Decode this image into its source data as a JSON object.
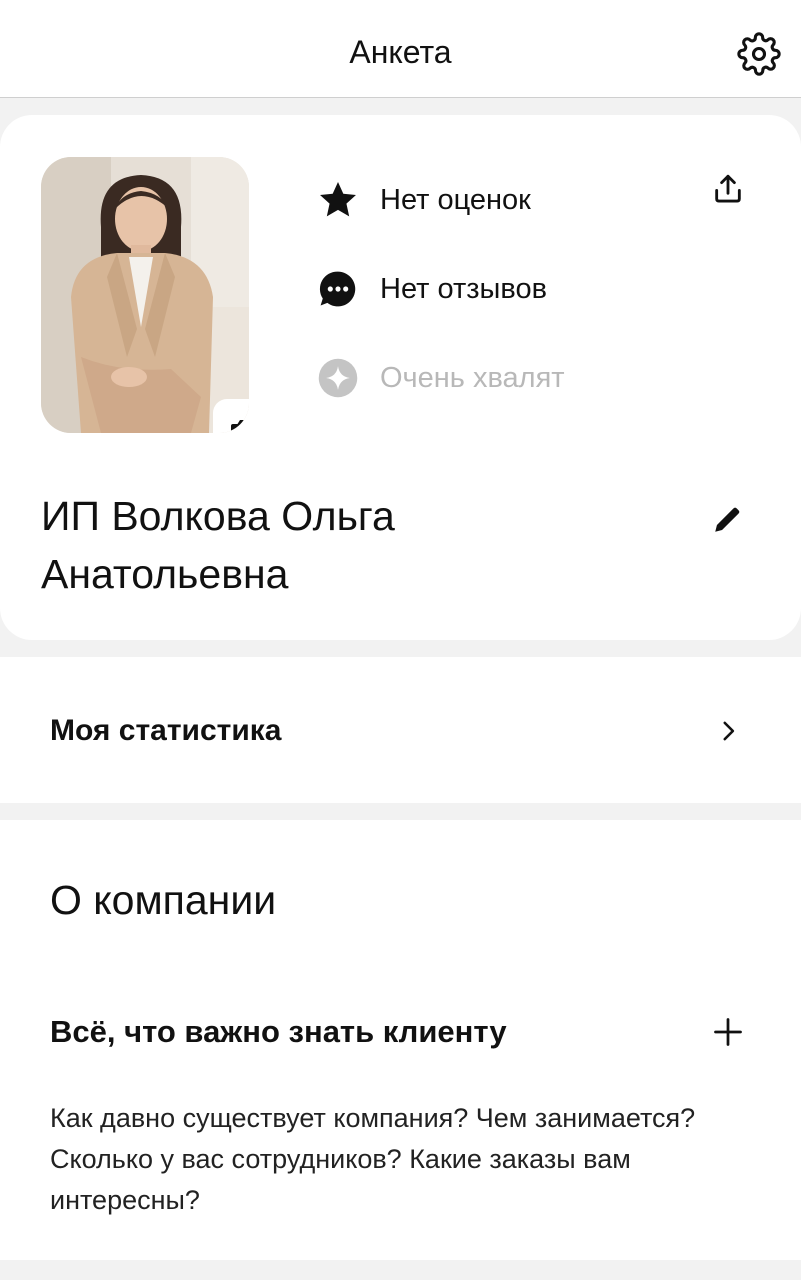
{
  "header": {
    "title": "Анкета",
    "settings_icon": "gear-icon"
  },
  "profile": {
    "photo_icon": "camera-icon",
    "rating_text": "Нет оценок",
    "reviews_text": "Нет отзывов",
    "praise_text": "Очень хвалят",
    "name_line1": "ИП Волкова Ольга",
    "name_line2": "Анатольевна",
    "share_icon": "share-icon",
    "edit_icon": "pencil-icon",
    "colors": {
      "muted": "#b8b8b8",
      "text": "#111111"
    }
  },
  "stats": {
    "label": "Моя статистика",
    "icon": "chevron-right-icon"
  },
  "about": {
    "title": "О компании",
    "subtitle": "Всё, что важно знать клиенту",
    "expand_icon": "plus-icon",
    "description": "Как давно существует компания? Чем занимается? Сколько у вас сотрудников? Какие заказы вам интересны?"
  }
}
